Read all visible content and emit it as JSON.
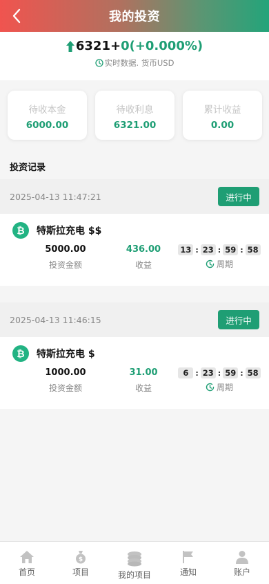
{
  "header": {
    "title": "我的投资",
    "back_icon": "chevron-left-icon"
  },
  "summary": {
    "value": "6321",
    "plus": " +",
    "change": "0(+0.000%)",
    "note": "实时数据. 货币USD",
    "up_color": "#1e9e74"
  },
  "stats": [
    {
      "label": "待收本金",
      "value": "6000.00"
    },
    {
      "label": "待收利息",
      "value": "6321.00"
    },
    {
      "label": "累计收益",
      "value": "0.00"
    }
  ],
  "section_title": "投资记录",
  "records": [
    {
      "date": "2025-04-13 11:47:21",
      "status": "进行中",
      "name": "特斯拉充电 $$",
      "amount": "5000.00",
      "amount_label": "投资金额",
      "income": "436.00",
      "income_label": "收益",
      "timer": [
        "13",
        "23",
        "59",
        "58"
      ],
      "timer_label": "周期"
    },
    {
      "date": "2025-04-13 11:46:15",
      "status": "进行中",
      "name": "特斯拉充电 $",
      "amount": "1000.00",
      "amount_label": "投资金额",
      "income": "31.00",
      "income_label": "收益",
      "timer": [
        "6",
        "23",
        "59",
        "58"
      ],
      "timer_label": "周期"
    }
  ],
  "tabbar": [
    {
      "label": "首页",
      "icon": "home-icon"
    },
    {
      "label": "项目",
      "icon": "money-bag-icon"
    },
    {
      "label": "我的项目",
      "icon": "coins-stack-icon"
    },
    {
      "label": "通知",
      "icon": "flag-icon"
    },
    {
      "label": "账户",
      "icon": "user-icon"
    }
  ],
  "colors": {
    "accent": "#1f9e74",
    "header_start": "#f0544f",
    "header_end": "#23a47a"
  }
}
